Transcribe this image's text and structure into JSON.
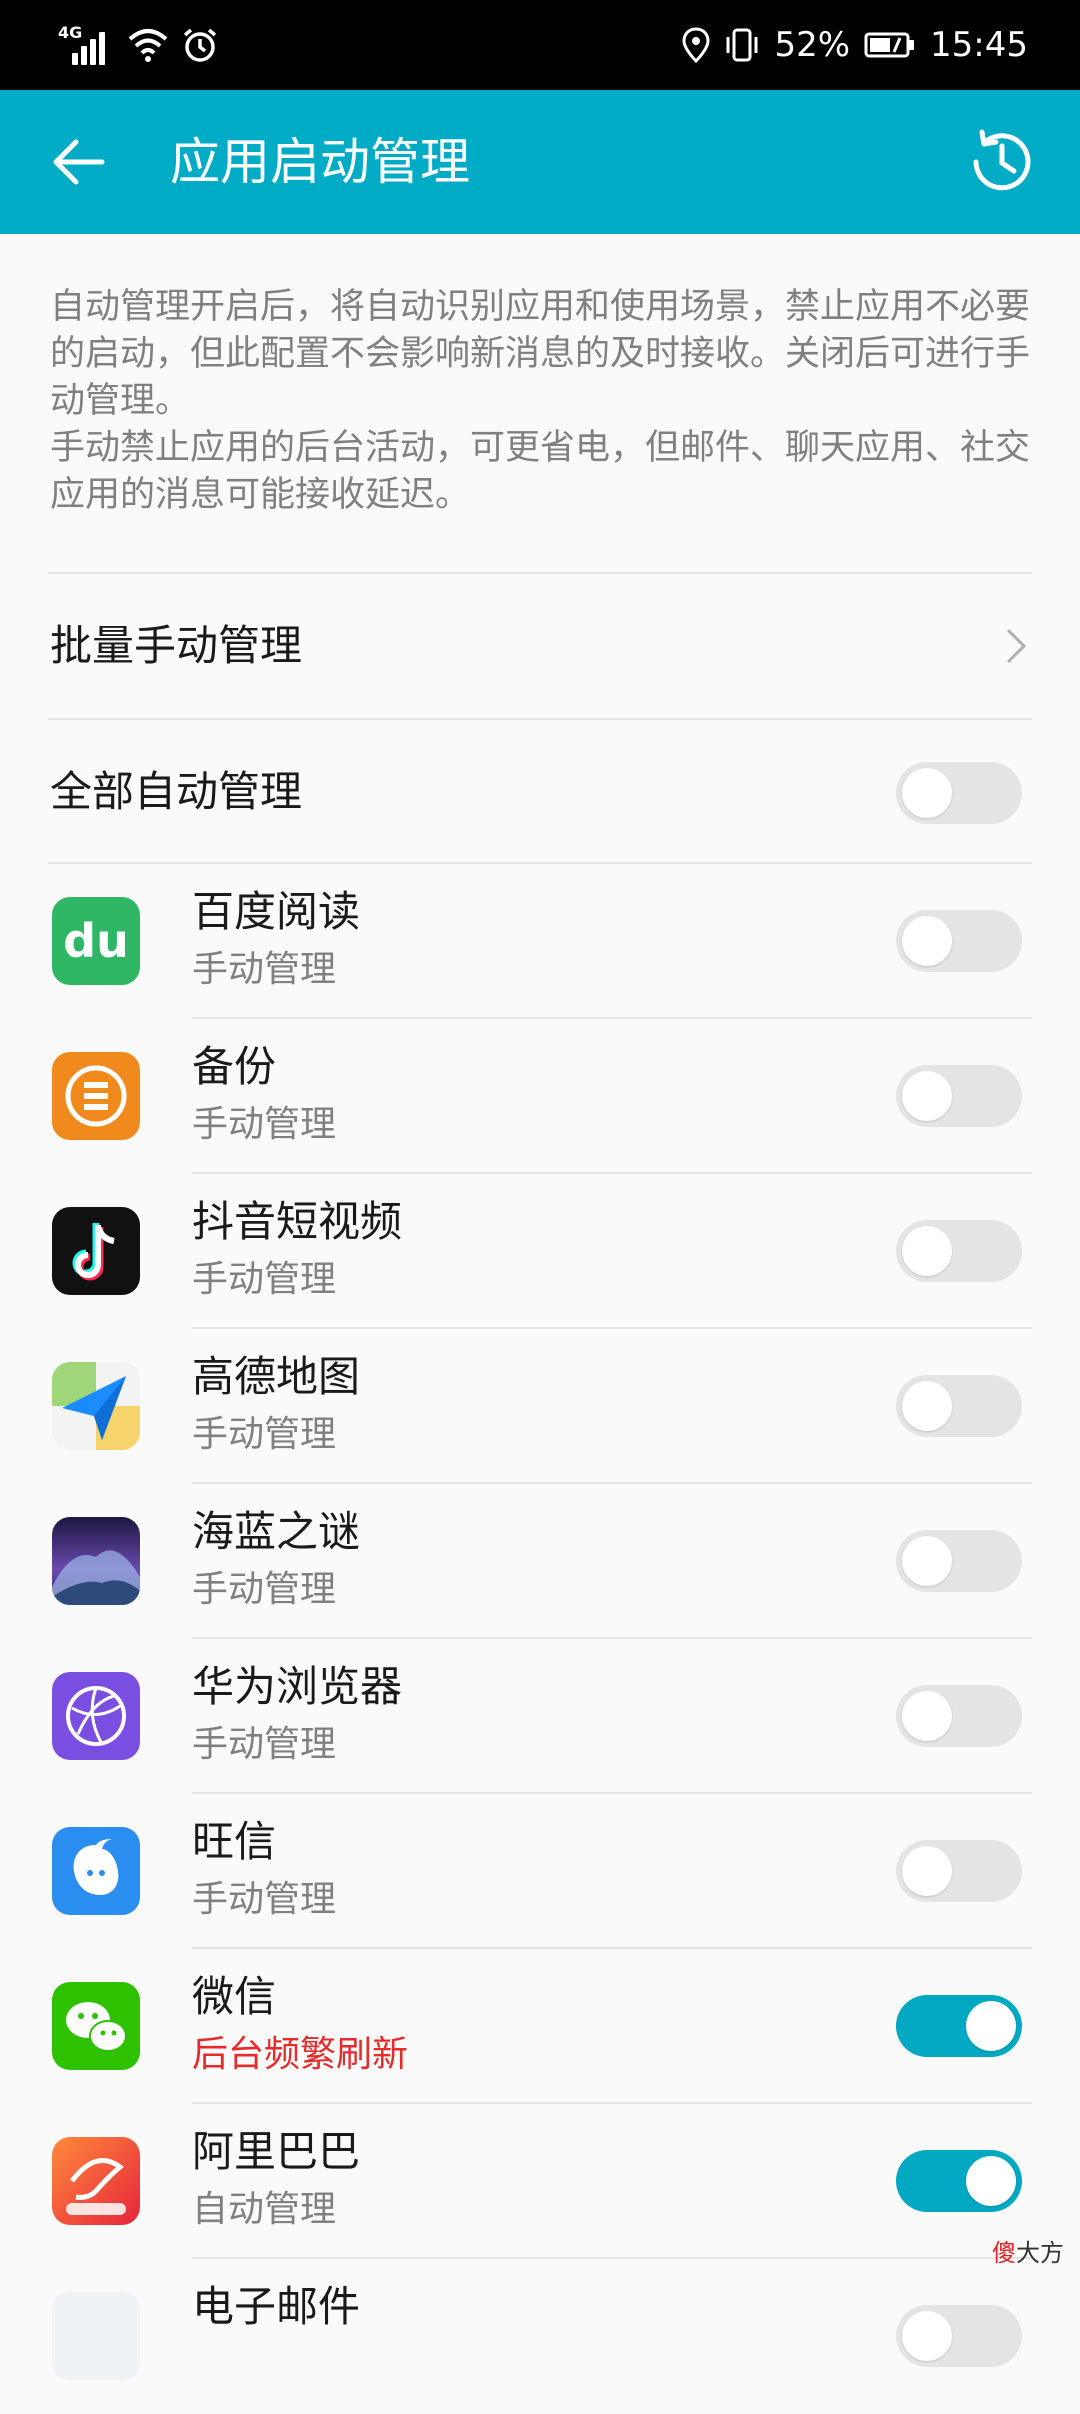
{
  "status_bar": {
    "network": "4G",
    "battery": "52%",
    "time": "15:45"
  },
  "app_bar": {
    "title": "应用启动管理",
    "back_icon": "back-arrow-icon",
    "history_icon": "history-clock-icon"
  },
  "description": {
    "line1": "自动管理开启后，将自动识别应用和使用场景，禁止应用不必要的启动，但此配置不会影响新消息的及时接收。关闭后可进行手动管理。",
    "line2": "手动禁止应用的后台活动，可更省电，但邮件、聊天应用、社交应用的消息可能接收延迟。"
  },
  "batch_manage": {
    "label": "批量手动管理"
  },
  "auto_all": {
    "label": "全部自动管理",
    "enabled": false
  },
  "apps": [
    {
      "name": "百度阅读",
      "status": "手动管理",
      "enabled": false,
      "icon": "baidu-read-icon"
    },
    {
      "name": "备份",
      "status": "手动管理",
      "enabled": false,
      "icon": "backup-icon"
    },
    {
      "name": "抖音短视频",
      "status": "手动管理",
      "enabled": false,
      "icon": "douyin-icon"
    },
    {
      "name": "高德地图",
      "status": "手动管理",
      "enabled": false,
      "icon": "amap-icon"
    },
    {
      "name": "海蓝之谜",
      "status": "手动管理",
      "enabled": false,
      "icon": "lamer-icon"
    },
    {
      "name": "华为浏览器",
      "status": "手动管理",
      "enabled": false,
      "icon": "huawei-browser-icon"
    },
    {
      "name": "旺信",
      "status": "手动管理",
      "enabled": false,
      "icon": "wangxin-icon"
    },
    {
      "name": "微信",
      "status": "后台频繁刷新",
      "enabled": true,
      "icon": "wechat-icon"
    },
    {
      "name": "阿里巴巴",
      "status": "自动管理",
      "enabled": true,
      "icon": "alibaba-icon"
    },
    {
      "name": "电子邮件",
      "status": "",
      "enabled": false,
      "icon": "email-icon"
    }
  ],
  "colors": {
    "accent": "#00abc6",
    "toggle_on": "#00a8c1",
    "warning": "#e52b2b"
  },
  "watermark": {
    "char1": "傻",
    "rest": "大方"
  }
}
